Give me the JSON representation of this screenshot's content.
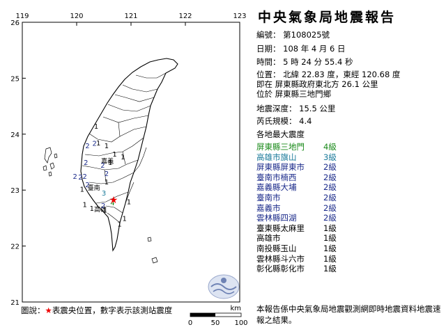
{
  "title": "中央氣象局地震報告",
  "report": {
    "number": "編號： 第108025號",
    "date": "日期： 108 年 4 月 6 日",
    "time": "時間： 5 時 24 分 55.4 秒",
    "position": "位置： 北緯 22.83 度，東經 120.68 度",
    "relative": "即在 屏東縣政府東北方 26.1 公里",
    "located": "位於 屏東縣三地門鄉",
    "depth": "地震深度： 15.5 公里",
    "magnitude": "芮氏規模： 4.4",
    "intensity_header": "各地最大震度"
  },
  "stations": [
    {
      "name": "屏東縣三地門",
      "level": "4級",
      "cls": "g4"
    },
    {
      "name": "高雄市旗山",
      "level": "3級",
      "cls": "g3"
    },
    {
      "name": "屏東縣屏東市",
      "level": "2級",
      "cls": "g2"
    },
    {
      "name": "臺南市楠西",
      "level": "2級",
      "cls": "g2"
    },
    {
      "name": "嘉義縣大埔",
      "level": "2級",
      "cls": "g2"
    },
    {
      "name": "臺南市",
      "level": "2級",
      "cls": "g2"
    },
    {
      "name": "嘉義市",
      "level": "2級",
      "cls": "g2"
    },
    {
      "name": "雲林縣四湖",
      "level": "2級",
      "cls": "g2"
    },
    {
      "name": "臺東縣太麻里",
      "level": "1級",
      "cls": "g1"
    },
    {
      "name": "高雄市",
      "level": "1級",
      "cls": "g1"
    },
    {
      "name": "南投縣玉山",
      "level": "1級",
      "cls": "g1"
    },
    {
      "name": "雲林縣斗六市",
      "level": "1級",
      "cls": "g1"
    },
    {
      "name": "彰化縣彰化市",
      "level": "1級",
      "cls": "g1"
    }
  ],
  "footnote": "本報告係中央氣象局地震觀測網即時地震資料地震速報之結果。",
  "map": {
    "lon_ticks": [
      "119",
      "120",
      "121",
      "122",
      "123"
    ],
    "lat_ticks": [
      "26",
      "25",
      "24",
      "23",
      "22",
      "21"
    ],
    "legend_prefix": "圖說：",
    "legend_star": "★",
    "legend_text": "表震央位置，數字表示該測站震度",
    "scale_unit": "km",
    "scale_labels": [
      "0",
      "50",
      "100"
    ],
    "epicenter": {
      "lon": 120.68,
      "lat": 22.83
    },
    "city_labels": [
      {
        "text": "臺南",
        "lon": 120.2,
        "lat": 23.0
      },
      {
        "text": "高雄",
        "lon": 120.32,
        "lat": 22.62
      },
      {
        "text": "嘉義",
        "lon": 120.45,
        "lat": 23.48
      }
    ],
    "intensity_marks": [
      {
        "v": "4",
        "lon": 120.66,
        "lat": 22.73,
        "color": "#1a8a1a"
      },
      {
        "v": "3",
        "lon": 120.5,
        "lat": 22.9,
        "color": "#1a7a9a"
      },
      {
        "v": "2",
        "lon": 120.49,
        "lat": 22.68,
        "color": "#1a2a8a"
      },
      {
        "v": "2",
        "lon": 120.2,
        "lat": 23.75,
        "color": "#1a2a8a"
      },
      {
        "v": "2",
        "lon": 120.33,
        "lat": 23.79,
        "color": "#1a2a8a"
      },
      {
        "v": "2",
        "lon": 120.17,
        "lat": 23.45,
        "color": "#1a2a8a"
      },
      {
        "v": "2",
        "lon": 120.15,
        "lat": 23.2,
        "color": "#1a2a8a"
      },
      {
        "v": "2",
        "lon": 119.97,
        "lat": 23.2,
        "color": "#1a2a8a"
      },
      {
        "v": "2",
        "lon": 120.07,
        "lat": 23.19,
        "color": "#1a2a8a"
      },
      {
        "v": "2",
        "lon": 120.55,
        "lat": 23.25,
        "color": "#1a2a8a"
      },
      {
        "v": "2",
        "lon": 120.48,
        "lat": 23.4,
        "color": "#1a2a8a"
      },
      {
        "v": "2",
        "lon": 120.2,
        "lat": 23.05,
        "color": "#1a2a8a"
      },
      {
        "v": "1",
        "lon": 120.36,
        "lat": 24.1,
        "color": "#000"
      },
      {
        "v": "1",
        "lon": 120.4,
        "lat": 23.8,
        "color": "#000"
      },
      {
        "v": "1",
        "lon": 120.55,
        "lat": 23.75,
        "color": "#000"
      },
      {
        "v": "1",
        "lon": 120.7,
        "lat": 23.6,
        "color": "#000"
      },
      {
        "v": "1",
        "lon": 120.85,
        "lat": 23.55,
        "color": "#000"
      },
      {
        "v": "1",
        "lon": 120.62,
        "lat": 23.45,
        "color": "#000"
      },
      {
        "v": "1",
        "lon": 120.55,
        "lat": 23.1,
        "color": "#000"
      },
      {
        "v": "1",
        "lon": 120.1,
        "lat": 22.97,
        "color": "#000"
      },
      {
        "v": "1",
        "lon": 120.15,
        "lat": 22.7,
        "color": "#000"
      },
      {
        "v": "1",
        "lon": 120.28,
        "lat": 22.63,
        "color": "#000"
      },
      {
        "v": "1",
        "lon": 120.52,
        "lat": 22.6,
        "color": "#000"
      },
      {
        "v": "1",
        "lon": 120.96,
        "lat": 22.75,
        "color": "#000"
      },
      {
        "v": "1",
        "lon": 120.88,
        "lat": 22.45,
        "color": "#000"
      },
      {
        "v": "1",
        "lon": 120.79,
        "lat": 22.35,
        "color": "#000"
      }
    ]
  }
}
